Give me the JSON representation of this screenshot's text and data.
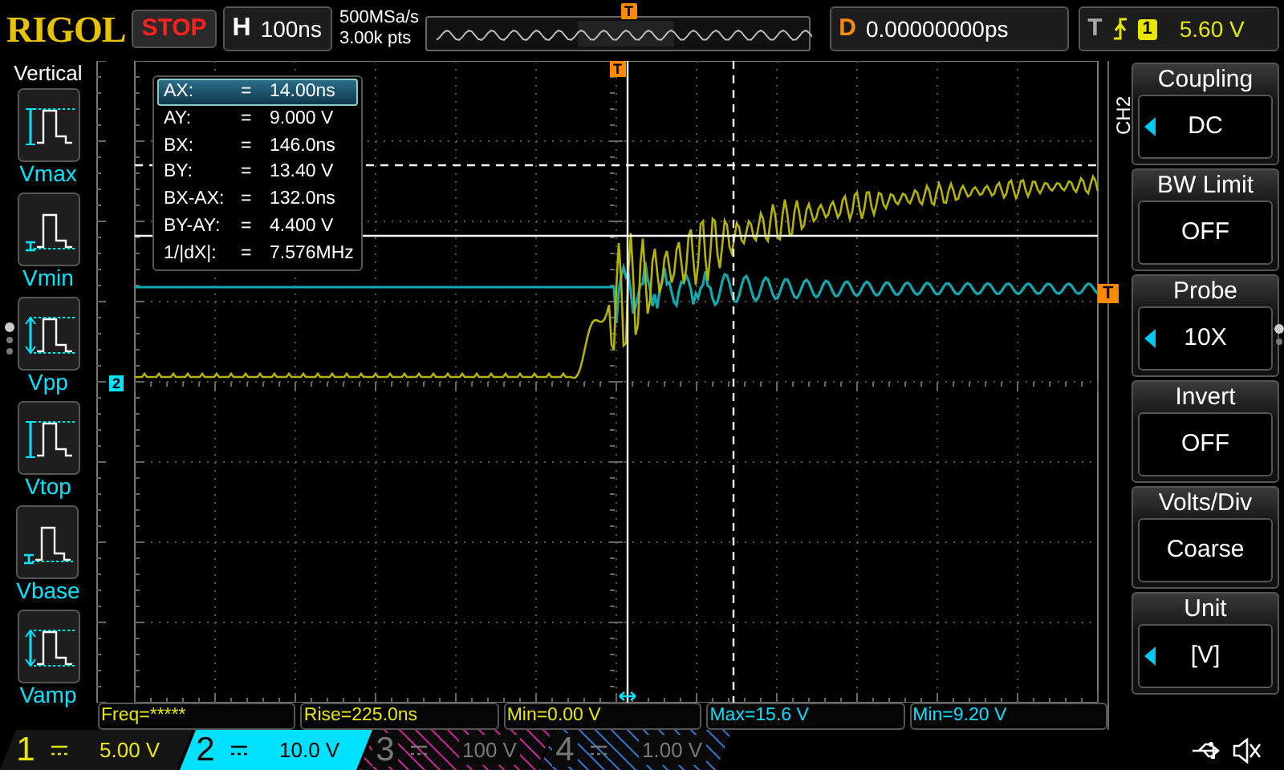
{
  "top_bar": {
    "logo": "RIGOL",
    "run_state": "STOP",
    "horizontal": {
      "label": "H",
      "scale": "100ns"
    },
    "sample_rate": "500MSa/s",
    "memory_depth": "3.00k pts",
    "overview_trigger_marker": "T",
    "delay": {
      "label": "D",
      "value": "0.00000000ps"
    },
    "trigger": {
      "label": "T",
      "source": "1",
      "level": "5.60 V"
    }
  },
  "left_panel": {
    "title": "Vertical",
    "items": [
      {
        "label": "Vmax",
        "kind": "vmax"
      },
      {
        "label": "Vmin",
        "kind": "vmin"
      },
      {
        "label": "Vpp",
        "kind": "vpp"
      },
      {
        "label": "Vtop",
        "kind": "vtop"
      },
      {
        "label": "Vbase",
        "kind": "vbase"
      },
      {
        "label": "Vamp",
        "kind": "vamp"
      }
    ]
  },
  "display": {
    "trigger_marker_top": "T",
    "trigger_level_marker": "T",
    "channel_marker": "2",
    "cursor_readout": [
      {
        "label": "AX:",
        "equals": "=",
        "value": "14.00ns",
        "selected": true
      },
      {
        "label": "AY:",
        "equals": "=",
        "value": "9.000 V",
        "selected": false
      },
      {
        "label": "BX:",
        "equals": "=",
        "value": "146.0ns",
        "selected": false
      },
      {
        "label": "BY:",
        "equals": "=",
        "value": "13.40 V",
        "selected": false
      },
      {
        "label": "BX-AX:",
        "equals": "=",
        "value": "132.0ns",
        "selected": false
      },
      {
        "label": "BY-AY:",
        "equals": "=",
        "value": "4.400 V",
        "selected": false
      },
      {
        "label": "1/|dX|:",
        "equals": "=",
        "value": "7.576MHz",
        "selected": false
      }
    ]
  },
  "right_menu": {
    "channel": "CH2",
    "items": [
      {
        "title": "Coupling",
        "value": "DC",
        "adjustable": true
      },
      {
        "title": "BW Limit",
        "value": "OFF",
        "adjustable": false
      },
      {
        "title": "Probe",
        "value": "10X",
        "adjustable": true
      },
      {
        "title": "Invert",
        "value": "OFF",
        "adjustable": false
      },
      {
        "title": "Volts/Div",
        "value": "Coarse",
        "adjustable": false
      },
      {
        "title": "Unit",
        "value": "[V]",
        "adjustable": true
      }
    ]
  },
  "measurement_bar": [
    {
      "text": "Freq=*****",
      "color": "#e6e600"
    },
    {
      "text": "Rise=225.0ns",
      "color": "#e6e600"
    },
    {
      "text": "Min=0.00 V",
      "color": "#e6e600"
    },
    {
      "text": "Max=15.6 V",
      "color": "#00e0ff"
    },
    {
      "text": "Min=9.20 V",
      "color": "#00e0ff"
    }
  ],
  "channels": [
    {
      "number": "1",
      "scale": "5.00 V",
      "enabled": true,
      "selected": false,
      "color": "#e6e600"
    },
    {
      "number": "2",
      "scale": "10.0 V",
      "enabled": true,
      "selected": true,
      "color": "#00e0ff"
    },
    {
      "number": "3",
      "scale": "100 V",
      "enabled": false,
      "selected": false,
      "color": "#c0208f"
    },
    {
      "number": "4",
      "scale": "1.00 V",
      "enabled": false,
      "selected": false,
      "color": "#2a6fc0"
    }
  ]
}
